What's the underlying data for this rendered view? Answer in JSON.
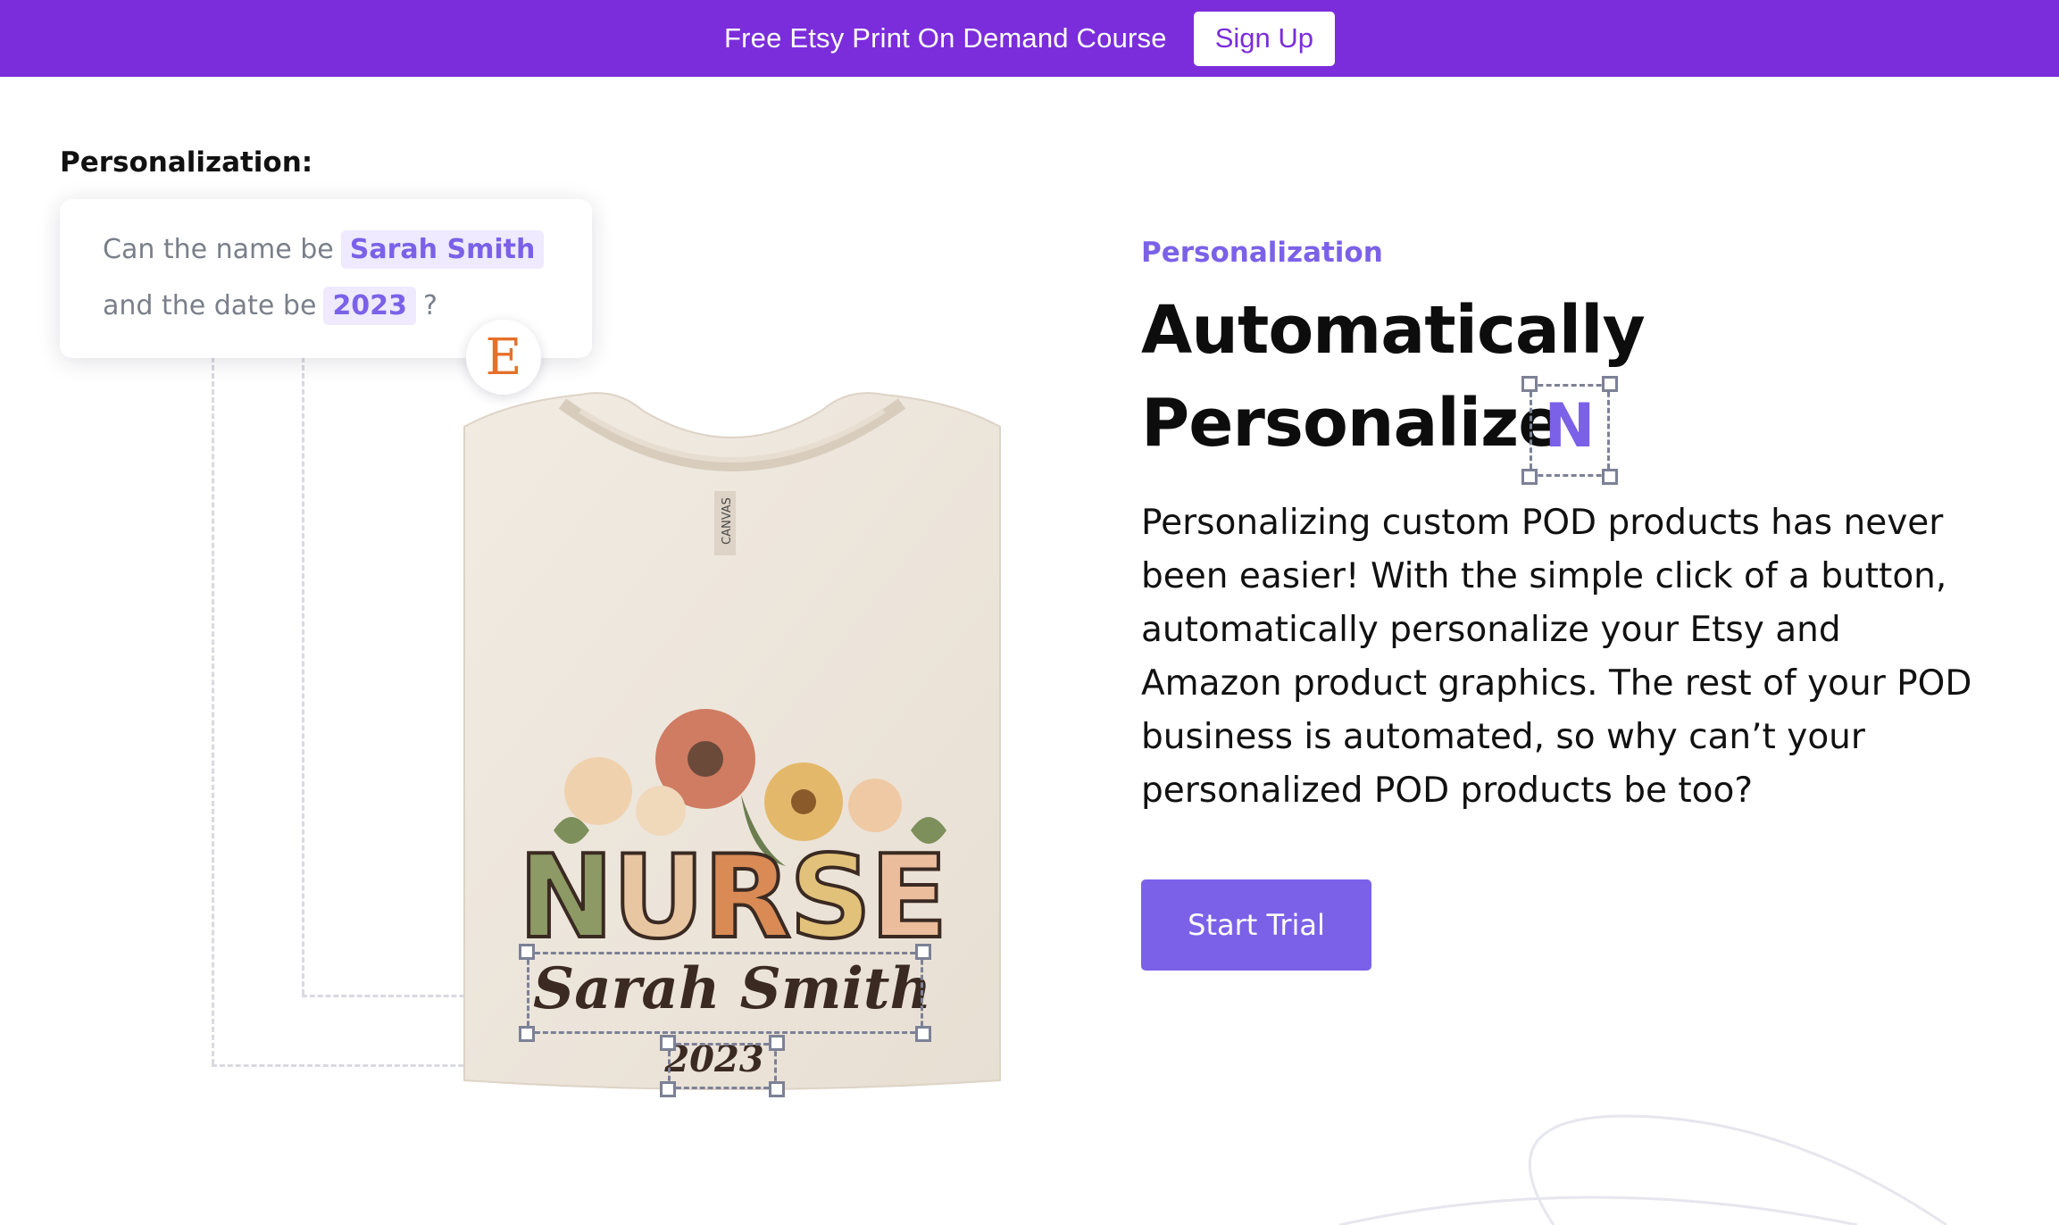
{
  "banner": {
    "text": "Free Etsy Print On Demand Course",
    "button_label": "Sign Up",
    "background_color": "#7b2ddb"
  },
  "illustration": {
    "heading": "Personalization:",
    "request": {
      "line1_prefix": "Can the name be",
      "name_value": "Sarah Smith",
      "line2_prefix": "and the date be",
      "date_value": "2023",
      "line2_suffix": "?"
    },
    "etsy_badge_letter": "E",
    "shirt": {
      "tag_text": "CANVAS",
      "design_word": [
        "N",
        "U",
        "R",
        "S",
        "E"
      ],
      "design_colors": [
        "#8e9a66",
        "#e9c6a2",
        "#d98a55",
        "#e2c27a",
        "#ebbd9c"
      ],
      "name": "Sarah Smith",
      "year": "2023"
    }
  },
  "content": {
    "eyebrow": "Personalization",
    "headline_line1": "Automatically",
    "headline_line2": "Personalize",
    "headline_glyph": "N",
    "body": "Personalizing custom POD products has never been easier! With the simple click of a button, automatically personalize your Etsy and Amazon product graphics. The rest of your POD business is automated, so why can’t your personalized POD products be too?",
    "cta_label": "Start Trial",
    "accent_color": "#7b61e8"
  }
}
